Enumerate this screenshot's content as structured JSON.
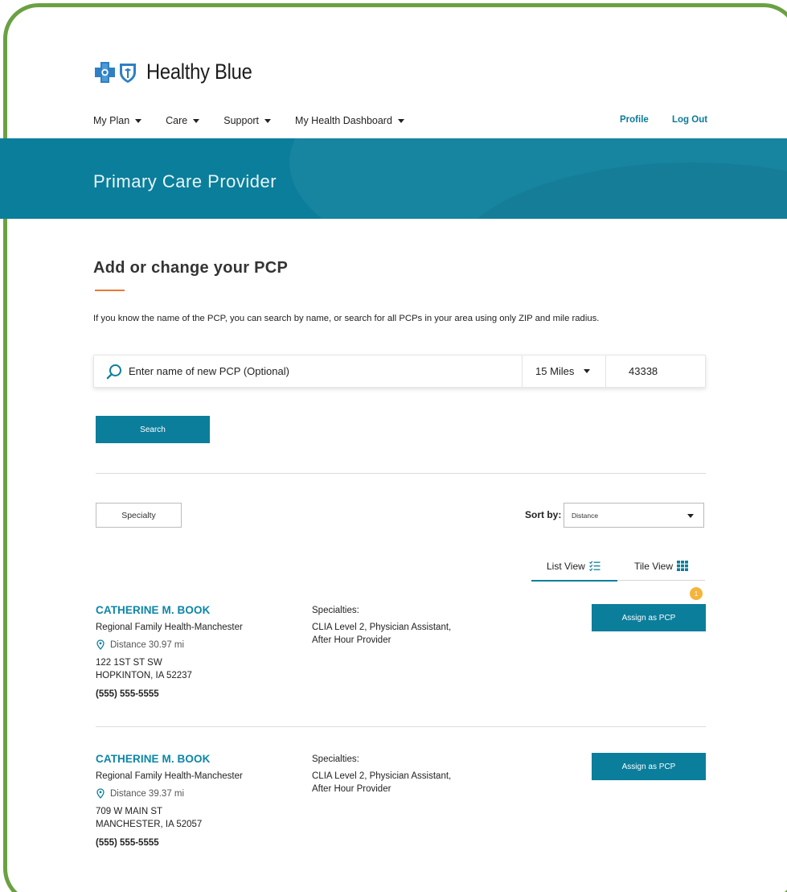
{
  "brand": {
    "name": "Healthy Blue",
    "accent": "#0b7e9b",
    "frame_color": "#6aa142",
    "underline_color": "#e8793a"
  },
  "nav": {
    "items": [
      {
        "label": "My Plan"
      },
      {
        "label": "Care"
      },
      {
        "label": "Support"
      },
      {
        "label": "My Health Dashboard"
      }
    ],
    "profile": "Profile",
    "logout": "Log Out"
  },
  "banner": {
    "title": "Primary Care Provider"
  },
  "section": {
    "title": "Add or change your PCP",
    "intro": "If you know the name of the PCP, you can search by name, or search for all PCPs in your area using only ZIP and mile radius."
  },
  "search": {
    "placeholder": "Enter name of new PCP (Optional)",
    "value": "",
    "radius": "15 Miles",
    "zip": "43338",
    "button": "Search"
  },
  "filters": {
    "specialty": "Specialty",
    "sort_label": "Sort by:",
    "sort_value": "Distance"
  },
  "views": {
    "list": "List View",
    "tile": "Tile View",
    "active": "list"
  },
  "results": [
    {
      "name": "CATHERINE M. BOOK",
      "organization": "Regional Family Health-Manchester",
      "distance": "Distance 30.97 mi",
      "address_line1": "122 1ST ST SW",
      "address_line2": "HOPKINTON, IA 52237",
      "phone": "(555) 555-5555",
      "specialties_label": "Specialties:",
      "specialties_line1": "CLIA Level 2, Physician Assistant,",
      "specialties_line2": "After Hour Provider",
      "action": "Assign as PCP",
      "badge": "1"
    },
    {
      "name": "CATHERINE M. BOOK",
      "organization": "Regional Family Health-Manchester",
      "distance": "Distance 39.37 mi",
      "address_line1": "709 W MAIN ST",
      "address_line2": "MANCHESTER, IA 52057",
      "phone": "(555) 555-5555",
      "specialties_label": "Specialties:",
      "specialties_line1": "CLIA Level 2, Physician Assistant,",
      "specialties_line2": "After Hour Provider",
      "action": "Assign as PCP"
    }
  ],
  "icons": {
    "logo_cross": "blue-cross-icon",
    "logo_shield": "blue-shield-icon",
    "search": "search-icon",
    "pin": "location-pin-icon",
    "list": "list-view-icon",
    "tile": "tile-grid-icon"
  }
}
